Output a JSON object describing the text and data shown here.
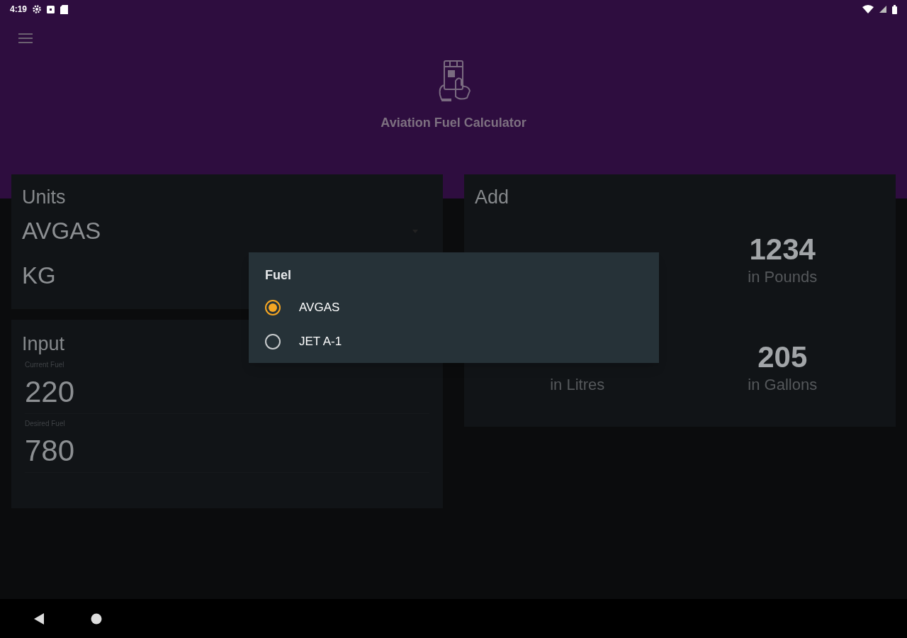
{
  "status_bar": {
    "time": "4:19"
  },
  "app_bar": {
    "title": "Aviation Fuel Calculator"
  },
  "units_card": {
    "title": "Units",
    "fuel": "AVGAS",
    "unit": "KG"
  },
  "input_card": {
    "title": "Input",
    "fields": [
      {
        "label": "Current Fuel",
        "value": "220"
      },
      {
        "label": "Desired Fuel",
        "value": "780"
      }
    ]
  },
  "add_card": {
    "title": "Add",
    "left_column": [
      {
        "caption": "in Litres"
      }
    ],
    "right_column": [
      {
        "value": "1234",
        "caption": "in Pounds"
      },
      {
        "value": "205",
        "caption": "in Gallons"
      }
    ]
  },
  "dialog": {
    "title": "Fuel",
    "options": [
      {
        "label": "AVGAS",
        "selected": true
      },
      {
        "label": "JET A-1",
        "selected": false
      }
    ]
  }
}
